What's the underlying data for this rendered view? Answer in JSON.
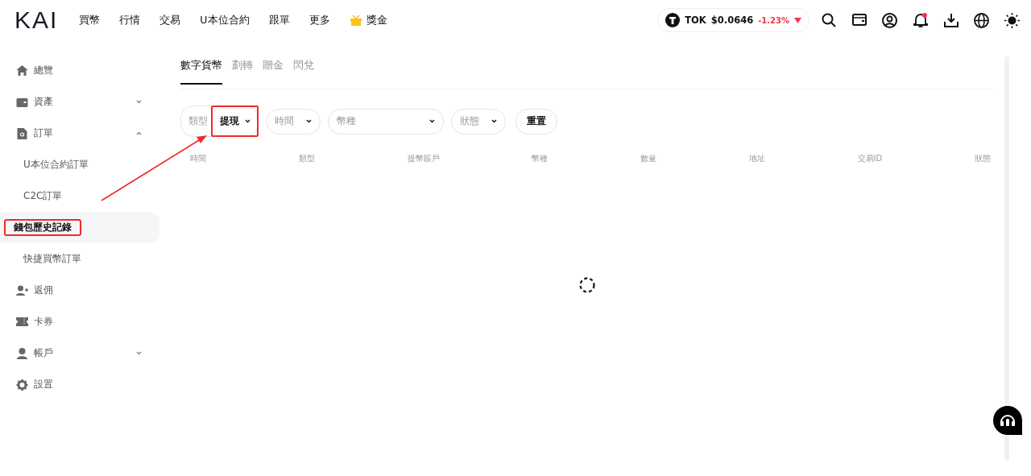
{
  "header": {
    "logo": "KAI",
    "nav": [
      {
        "label": "買幣",
        "kind": "link"
      },
      {
        "label": "行情",
        "kind": "link"
      },
      {
        "label": "交易",
        "kind": "link"
      },
      {
        "label": "U本位合約",
        "kind": "link"
      },
      {
        "label": "跟單",
        "kind": "link"
      },
      {
        "label": "更多",
        "kind": "link"
      },
      {
        "label": "獎金",
        "kind": "reward"
      }
    ],
    "token": {
      "symbol": "TOK",
      "price": "$0.0646",
      "change": "-1.23%"
    },
    "notification_dot": true
  },
  "sidebar": {
    "items": [
      {
        "label": "總覽",
        "selected": false
      },
      {
        "label": "資產",
        "selected": false,
        "expanded": false
      },
      {
        "label": "訂單",
        "selected": false,
        "expanded": true,
        "children": [
          {
            "label": "U本位合約訂單",
            "selected": false,
            "highlighted": false
          },
          {
            "label": "C2C訂單",
            "selected": false,
            "highlighted": false
          },
          {
            "label": "錢包歷史記錄",
            "selected": true,
            "highlighted": true
          },
          {
            "label": "快捷買幣訂單",
            "selected": false,
            "highlighted": false
          }
        ]
      },
      {
        "label": "返佣",
        "selected": false
      },
      {
        "label": "卡券",
        "selected": false
      },
      {
        "label": "帳戶",
        "selected": false,
        "expanded": false
      },
      {
        "label": "設置",
        "selected": false
      }
    ]
  },
  "tabs": [
    {
      "label": "數字貨幣",
      "selected": true
    },
    {
      "label": "劃轉",
      "selected": false
    },
    {
      "label": "贈金",
      "selected": false
    },
    {
      "label": "閃兌",
      "selected": false
    }
  ],
  "filters": [
    {
      "kind": "labeled",
      "label": "類型",
      "value": "提現",
      "highlighted": true
    },
    {
      "kind": "select",
      "placeholder": "時間"
    },
    {
      "kind": "select",
      "placeholder": "幣種"
    },
    {
      "kind": "select",
      "placeholder": "狀態"
    },
    {
      "kind": "button",
      "label": "重置"
    }
  ],
  "table": {
    "columns": [
      "時間",
      "類型",
      "提幣賬戶",
      "幣種",
      "數量",
      "地址",
      "交易ID",
      "狀態"
    ],
    "loading": true
  }
}
